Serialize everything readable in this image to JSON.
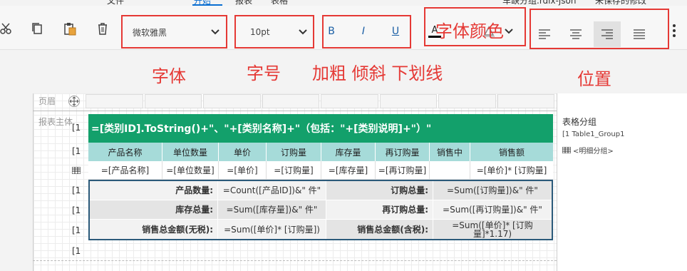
{
  "top_tabs": [
    "文件",
    "开始",
    "报表",
    "表格"
  ],
  "top_title": "车缺分组.rdlx-json",
  "top_extra": "未保存的修改",
  "toolbar": {
    "font_family": "微软雅黑",
    "font_size": "10pt",
    "bold": "B",
    "italic": "I",
    "underline": "U",
    "font_color_label": "A"
  },
  "annotations": {
    "font": "字体",
    "size": "字号",
    "style": "加粗 倾斜 下划线",
    "color": "字体颜色",
    "position": "位置"
  },
  "band_labels": {
    "page_header": "页眉",
    "report_body": "报表主体"
  },
  "row_markers": [
    "[1",
    "[1",
    "[1",
    "[1",
    "[1",
    "[1",
    "[1"
  ],
  "table": {
    "title": "=[类别ID].ToString()+\"、\"+[类别名称]+\"（包括：\"+[类别说明]+\"）\"",
    "headers": [
      "产品名称",
      "单位数量",
      "单价",
      "订购量",
      "库存量",
      "再订购量",
      "销售中",
      "销售额"
    ],
    "detail": [
      "=[产品名称]",
      "=[单位数量]",
      "=[单价]",
      "=[订购量]",
      "=[库存量]",
      "=[再订购量]",
      "",
      "=[单价]* [订购量]"
    ],
    "summary": [
      [
        "产品数量:",
        "=Count([产品ID])&\" 件\"",
        "订购总量:",
        "=Sum([订购量])&\" 件\""
      ],
      [
        "库存总量:",
        "=Sum([库存量])&\" 件\"",
        "再订购总量:",
        "=Sum([再订购量])&\" 件\""
      ],
      [
        "销售总金额(无税):",
        "=Sum([单价]* [订购量])",
        "销售总金额(含税):",
        "=Sum([单价]* [订购量]*1.17)"
      ]
    ]
  },
  "right_panel": {
    "title": "表格分组",
    "group_item": "[1 Table1_Group1",
    "detail_item": "<明细分组>"
  },
  "colors": {
    "title_bg": "#13a06b",
    "header_bg": "#a6dbd9",
    "annotation": "#e53935",
    "accent": "#0a6ed1"
  }
}
